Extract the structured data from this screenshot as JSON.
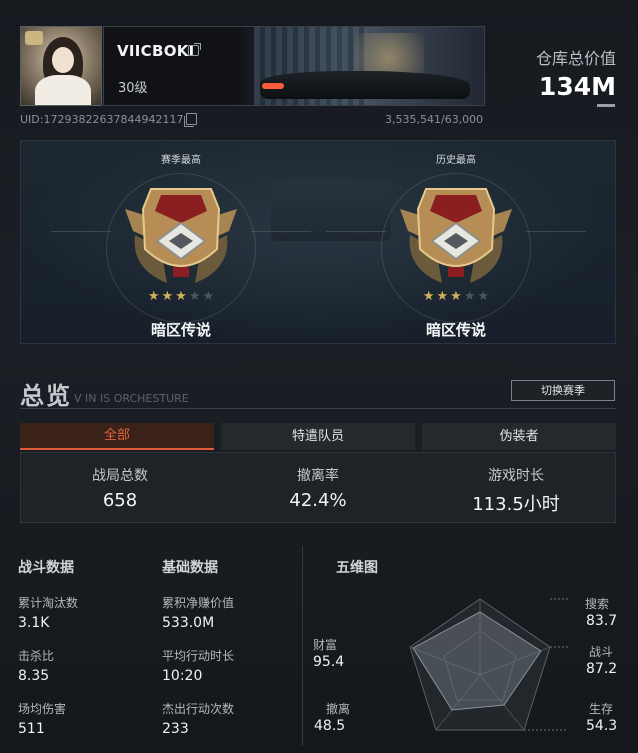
{
  "profile": {
    "name": "VIICBOKI",
    "level": "30级",
    "uid": "UID:172938226378449421​17",
    "xp": "3,535,541/63,000"
  },
  "vault": {
    "label": "仓库总价值",
    "value": "134M"
  },
  "ranks": [
    {
      "title": "赛季最高",
      "name": "暗区传说",
      "stars_on": 3,
      "stars_total": 5
    },
    {
      "title": "历史最高",
      "name": "暗区传说",
      "stars_on": 3,
      "stars_total": 5
    }
  ],
  "overview": {
    "title": "总览",
    "subtitle": "V IN IS ORCHESTURE",
    "season_button": "切换赛季",
    "tabs": [
      {
        "label": "全部",
        "active": true
      },
      {
        "label": "特遣队员",
        "active": false
      },
      {
        "label": "伪装者",
        "active": false
      }
    ],
    "summary": [
      {
        "label": "战局总数",
        "value": "658"
      },
      {
        "label": "撤离率",
        "value": "42.4%"
      },
      {
        "label": "游戏时长",
        "value": "113.5小时"
      }
    ]
  },
  "combat": {
    "title": "战斗数据",
    "items": [
      {
        "label": "累计淘汰数",
        "value": "3.1K"
      },
      {
        "label": "击杀比",
        "value": "8.35"
      },
      {
        "label": "场均伤害",
        "value": "511"
      }
    ]
  },
  "basic": {
    "title": "基础数据",
    "items": [
      {
        "label": "累积净赚价值",
        "value": "533.0M"
      },
      {
        "label": "平均行动时长",
        "value": "10:20"
      },
      {
        "label": "杰出行动次数",
        "value": "233"
      }
    ]
  },
  "radar": {
    "title": "五维图",
    "axes": [
      {
        "label": "搜索",
        "value": "83.7"
      },
      {
        "label": "战斗",
        "value": "87.2"
      },
      {
        "label": "生存",
        "value": "54.3"
      },
      {
        "label": "撤离",
        "value": "48.5"
      },
      {
        "label": "财富",
        "value": "95.4"
      }
    ]
  },
  "colors": {
    "accent": "#e15b36",
    "star_on": "#d4b05c",
    "star_off": "#4b545c"
  }
}
